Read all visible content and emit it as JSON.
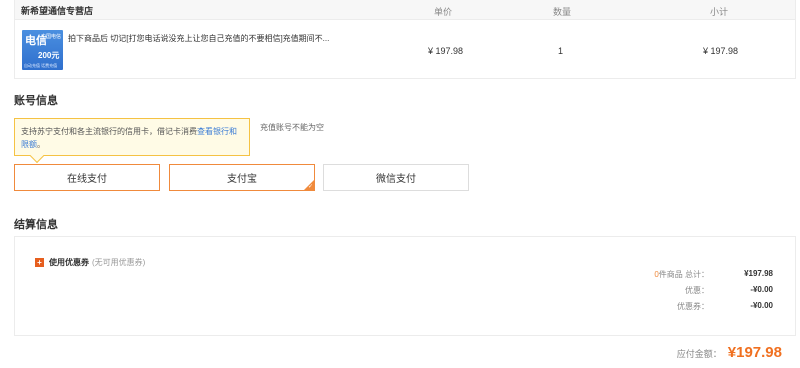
{
  "order": {
    "store_name": "新希望通信专营店",
    "headers": {
      "price": "单价",
      "qty": "数量",
      "subtotal": "小计"
    },
    "product": {
      "thumb_title": "电信",
      "thumb_badge": "中国电信",
      "thumb_amount": "200元",
      "thumb_foot": "自动充值 话费充值",
      "description": "拍下商品后 切记[打您电话说没充上让您自己充值的不要相信]充值期间不...",
      "price": "¥ 197.98",
      "qty": "1",
      "subtotal": "¥ 197.98"
    }
  },
  "account": {
    "title": "账号信息",
    "hint": "充值账号不能为空"
  },
  "tooltip": {
    "text": "支持苏宁支付和各主流银行的信用卡，借记卡消费",
    "link": "查看银行和限额",
    "suffix": "。"
  },
  "payment": {
    "online": "在线支付",
    "alipay": "支付宝",
    "wechat": "微信支付"
  },
  "settlement": {
    "title": "结算信息",
    "coupon_label": "使用优惠券",
    "coupon_note": "(无可用优惠券)",
    "count": "0",
    "count_suffix": "件商品  总计：",
    "total_goods": "¥197.98",
    "discount_label": "优惠：",
    "discount_value": "-¥0.00",
    "coupon_sum_label": "优惠券：",
    "coupon_sum_value": "-¥0.00",
    "payable_label": "应付金额：",
    "payable_value": "¥197.98"
  },
  "colors": {
    "accent": "#f08a3c",
    "total": "#f07020",
    "link": "#3a7bd5"
  }
}
